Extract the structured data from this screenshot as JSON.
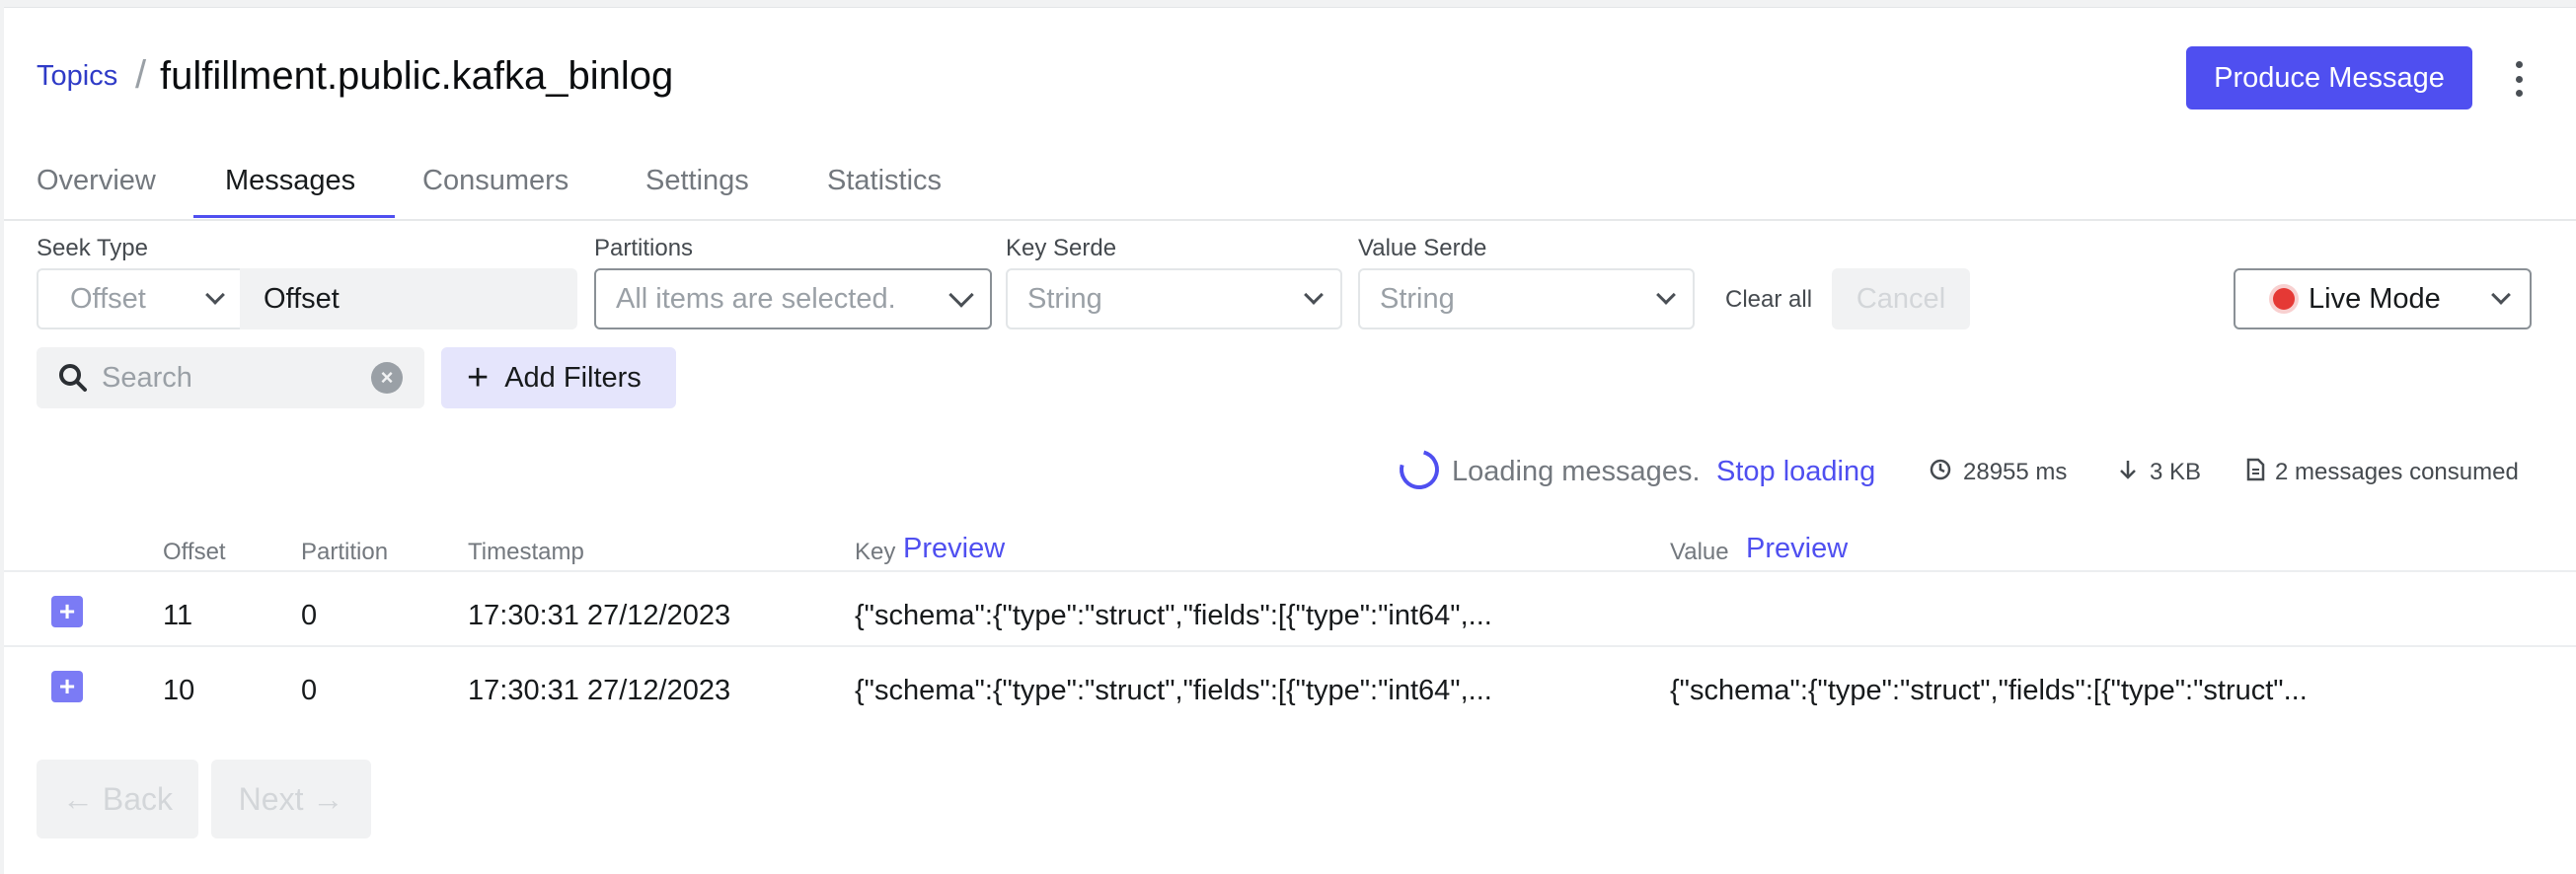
{
  "breadcrumb": {
    "link": "Topics",
    "separator": "/"
  },
  "page_title": "fulfillment.public.kafka_binlog",
  "produce_button": "Produce Message",
  "tabs": [
    {
      "label": "Overview",
      "active": false
    },
    {
      "label": "Messages",
      "active": true
    },
    {
      "label": "Consumers",
      "active": false
    },
    {
      "label": "Settings",
      "active": false
    },
    {
      "label": "Statistics",
      "active": false
    }
  ],
  "filters": {
    "seek_type": {
      "label": "Seek Type",
      "value": "Offset",
      "input_value": "Offset"
    },
    "partitions": {
      "label": "Partitions",
      "placeholder": "All items are selected."
    },
    "key_serde": {
      "label": "Key Serde",
      "value": "String"
    },
    "value_serde": {
      "label": "Value Serde",
      "value": "String"
    },
    "clear_all": "Clear all",
    "cancel": "Cancel",
    "mode": "Live Mode"
  },
  "search": {
    "placeholder": "Search",
    "clear": "×"
  },
  "add_filters": {
    "plus": "+",
    "label": "Add Filters"
  },
  "status": {
    "loading": "Loading messages.",
    "stop": "Stop loading",
    "elapsed": "28955 ms",
    "size": "3 KB",
    "consumed": "2 messages consumed"
  },
  "table": {
    "headers": {
      "offset": "Offset",
      "partition": "Partition",
      "timestamp": "Timestamp",
      "key": "Key",
      "value": "Value",
      "preview": "Preview"
    },
    "rows": [
      {
        "offset": "11",
        "partition": "0",
        "timestamp": "17:30:31 27/12/2023",
        "key": "{\"schema\":{\"type\":\"struct\",\"fields\":[{\"type\":\"int64\",...",
        "value": ""
      },
      {
        "offset": "10",
        "partition": "0",
        "timestamp": "17:30:31 27/12/2023",
        "key": "{\"schema\":{\"type\":\"struct\",\"fields\":[{\"type\":\"int64\",...",
        "value": "{\"schema\":{\"type\":\"struct\",\"fields\":[{\"type\":\"struct\"..."
      }
    ]
  },
  "pager": {
    "back": "← Back",
    "next": "Next →"
  },
  "colors": {
    "accent": "#4f4ff0",
    "live": "#e53935"
  },
  "icons": [
    "kebab-menu-icon",
    "chevron-down-icon",
    "search-icon",
    "clear-icon",
    "plus-icon",
    "spinner-icon",
    "clock-icon",
    "arrow-down-icon",
    "document-icon",
    "expand-icon",
    "live-dot-icon"
  ]
}
